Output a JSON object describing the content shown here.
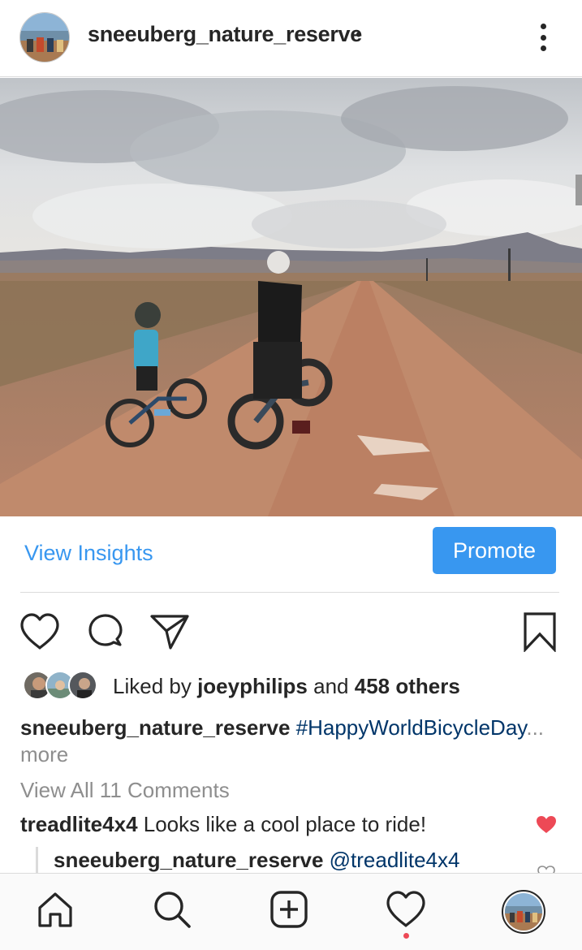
{
  "header": {
    "username": "sneeuberg_nature_reserve",
    "separator": "•",
    "more_icon": "more-vertical-icon"
  },
  "post": {
    "image_subject": "photo"
  },
  "insights": {
    "view_insights_label": "View Insights",
    "promote_label": "Promote",
    "accent_color": "#3897f0"
  },
  "actions": {
    "icons": [
      "heart-icon",
      "comment-icon",
      "share-icon",
      "bookmark-icon"
    ]
  },
  "likes": {
    "prefix": "Liked by",
    "first_liker": "joeyphilips",
    "connector": "and",
    "others": "458 others"
  },
  "caption": {
    "username": "sneeuberg_nature_reserve",
    "text": "#HappyWorldBicycleDay",
    "ellipsis": "...",
    "more": "more"
  },
  "comments": {
    "view_all": "View All 11 Comments",
    "items": [
      {
        "user": "treadlite4x4",
        "text": "Looks like a cool place to ride!",
        "liked": true
      }
    ],
    "reply": {
      "user": "sneeuberg_nature_reserve",
      "mention": "@treadlite4x4"
    }
  },
  "bottom_nav": {
    "items": [
      "home-icon",
      "search-icon",
      "new-post-icon",
      "activity-icon",
      "profile-avatar"
    ],
    "activity_badge_color": "#ed4956"
  }
}
